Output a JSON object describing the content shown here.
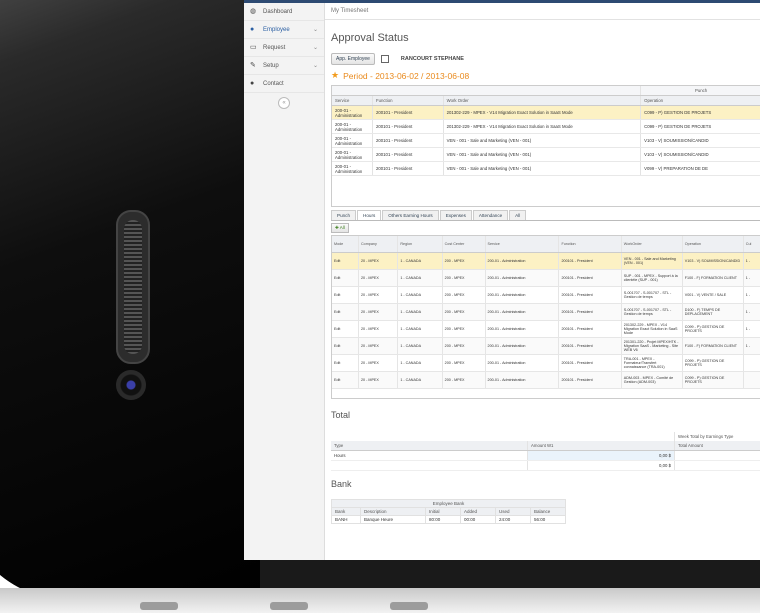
{
  "sidebar": {
    "items": [
      {
        "icon": "dashboard-icon",
        "label": "Dashboard",
        "chevron": ""
      },
      {
        "icon": "user-icon",
        "label": "Employee",
        "chevron": "⌄"
      },
      {
        "icon": "mail-icon",
        "label": "Request",
        "chevron": "⌄"
      },
      {
        "icon": "edit-icon",
        "label": "Setup",
        "chevron": "⌄"
      },
      {
        "icon": "chat-icon",
        "label": "Contact",
        "chevron": ""
      }
    ],
    "collapse": "«"
  },
  "breadcrumb": "My Timesheet",
  "title": "Approval Status",
  "approve_button": "App. Employee",
  "employee_name": "RANCOURT STEPHANE",
  "period": "Period - 2013-06-02 / 2013-06-08",
  "work_orders": {
    "group_header": "Punch",
    "columns": [
      "Service",
      "Function",
      "Work Order",
      "Operation"
    ],
    "rows": [
      [
        "200-01 - Administration",
        "200101 - President",
        "201302-229 - MPEX - V14 Migration Exact Solution in SaaS Mode",
        "C099 - P) GESTION DE PROJETS"
      ],
      [
        "200-01 - Administration",
        "200101 - President",
        "201302-229 - MPEX - V14 Migration Exact Solution in SaaS Mode",
        "C099 - P) GESTION DE PROJETS"
      ],
      [
        "200-01 - Administration",
        "200101 - President",
        "VEN - 001 - Sale and Marketing (VEN - 001)",
        "V103 - V) SOUMISSION/CANDID"
      ],
      [
        "200-01 - Administration",
        "200101 - President",
        "VEN - 001 - Sale and Marketing (VEN - 001)",
        "V103 - V) SOUMISSION/CANDID"
      ],
      [
        "200-01 - Administration",
        "200101 - President",
        "VEN - 001 - Sale and Marketing (VEN - 001)",
        "V099 - V) PREPARATION DE DE"
      ]
    ]
  },
  "tabs": [
    "Punch",
    "Hours",
    "Others Earning Hours",
    "Expenses",
    "Attendance",
    "All"
  ],
  "add_label": "All",
  "grid": {
    "columns": [
      "Mode",
      "Company",
      "Region",
      "Cost Center",
      "Service",
      "Function",
      "WorkOrder",
      "Operation",
      "Cul"
    ],
    "rows": [
      [
        "Edit",
        "20 - MPEX",
        "1 - CANADA",
        "200 - MPEX",
        "200-01 - Administration",
        "200101 - President",
        "VEN - 001 - Sale and Marketing (VEN - 001)",
        "V103 - V) SOUMISSION/CANDID",
        "1 -"
      ],
      [
        "Edit",
        "20 - MPEX",
        "1 - CANADA",
        "200 - MPEX",
        "200-01 - Administration",
        "200101 - President",
        "SUP - 001 - MPEX - Support à la clientèle (SUP - 001)",
        "F100 - F) FORMATION CLIENT",
        "1 -"
      ],
      [
        "Edit",
        "20 - MPEX",
        "1 - CANADA",
        "200 - MPEX",
        "200-01 - Administration",
        "200101 - President",
        "S-001707 - S-001707 - STL - Gestion de temps",
        "V001 - V) VENTE / SALE",
        "1 -"
      ],
      [
        "Edit",
        "20 - MPEX",
        "1 - CANADA",
        "200 - MPEX",
        "200-01 - Administration",
        "200101 - President",
        "S-001707 - S-001707 - STL - Gestion de temps",
        "D100 - F) TEMPS DE DEPLACEMENT",
        "1 -"
      ],
      [
        "Edit",
        "20 - MPEX",
        "1 - CANADA",
        "200 - MPEX",
        "200-01 - Administration",
        "200101 - President",
        "201302-229 - MPEX - V14 Migration Exact Solution in SaaS Mode",
        "C099 - P) GESTION DE PROJETS",
        "1 -"
      ],
      [
        "Edit",
        "20 - MPEX",
        "1 - CANADA",
        "200 - MPEX",
        "200-01 - Administration",
        "200101 - President",
        "201301-220 - Projet MPEX/HTK - Migration SaaS - Marketing - Site WEB V6",
        "F100 - F) FORMATION CLIENT",
        "1 -"
      ],
      [
        "Edit",
        "20 - MPEX",
        "1 - CANADA",
        "200 - MPEX",
        "200-01 - Administration",
        "200101 - President",
        "TRA-001 - MPEX - Formateur/Transfert connaissance (TRA-001)",
        "C099 - P) GESTION DE PROJETS",
        ""
      ],
      [
        "Edit",
        "20 - MPEX",
        "1 - CANADA",
        "200 - MPEX",
        "200-01 - Administration",
        "200101 - President",
        "ADM-003 - MPEX - Comité de Gestion (ADM-003)",
        "C099 - P) GESTION DE PROJETS",
        ""
      ]
    ]
  },
  "total": {
    "title": "Total",
    "group_header": "Week Total by Earnings Type",
    "columns": [
      "Type",
      "Amount W1",
      "Total Amount"
    ],
    "rows": [
      [
        "Hours",
        "0,00 $",
        ""
      ],
      [
        "",
        "0,00 $",
        ""
      ]
    ]
  },
  "bank": {
    "title": "Bank",
    "group_header": "Employee Bank",
    "columns": [
      "Bank",
      "Description",
      "Initial",
      "Added",
      "Used",
      "Balance"
    ],
    "rows": [
      [
        "BANH",
        "Banque Heure",
        "80:00",
        "00:00",
        "24:00",
        "56:00"
      ]
    ]
  },
  "colors": {
    "accent": "#2d4a72",
    "period": "#e98a1d",
    "selected_row": "#fcf1c4"
  }
}
